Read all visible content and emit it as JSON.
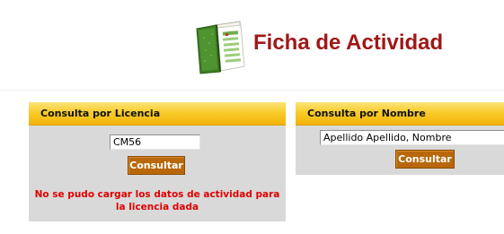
{
  "header": {
    "title": "Ficha de Actividad",
    "title_color": "#a01818",
    "logo_icon": "book-document-icon"
  },
  "licencia_panel": {
    "title": "Consulta por Licencia",
    "input_value": "CM56",
    "button_label": "Consultar",
    "error_message": "No se pudo cargar los datos de actividad para la licencia dada",
    "error_color": "#e00000"
  },
  "nombre_panel": {
    "title": "Consulta por Nombre",
    "input_value": "Apellido Apellido, Nombre",
    "button_label": "Consultar"
  },
  "colors": {
    "panel_header": "#f8cd2a",
    "panel_body": "#d9d9d9",
    "button": "#b8680a"
  }
}
